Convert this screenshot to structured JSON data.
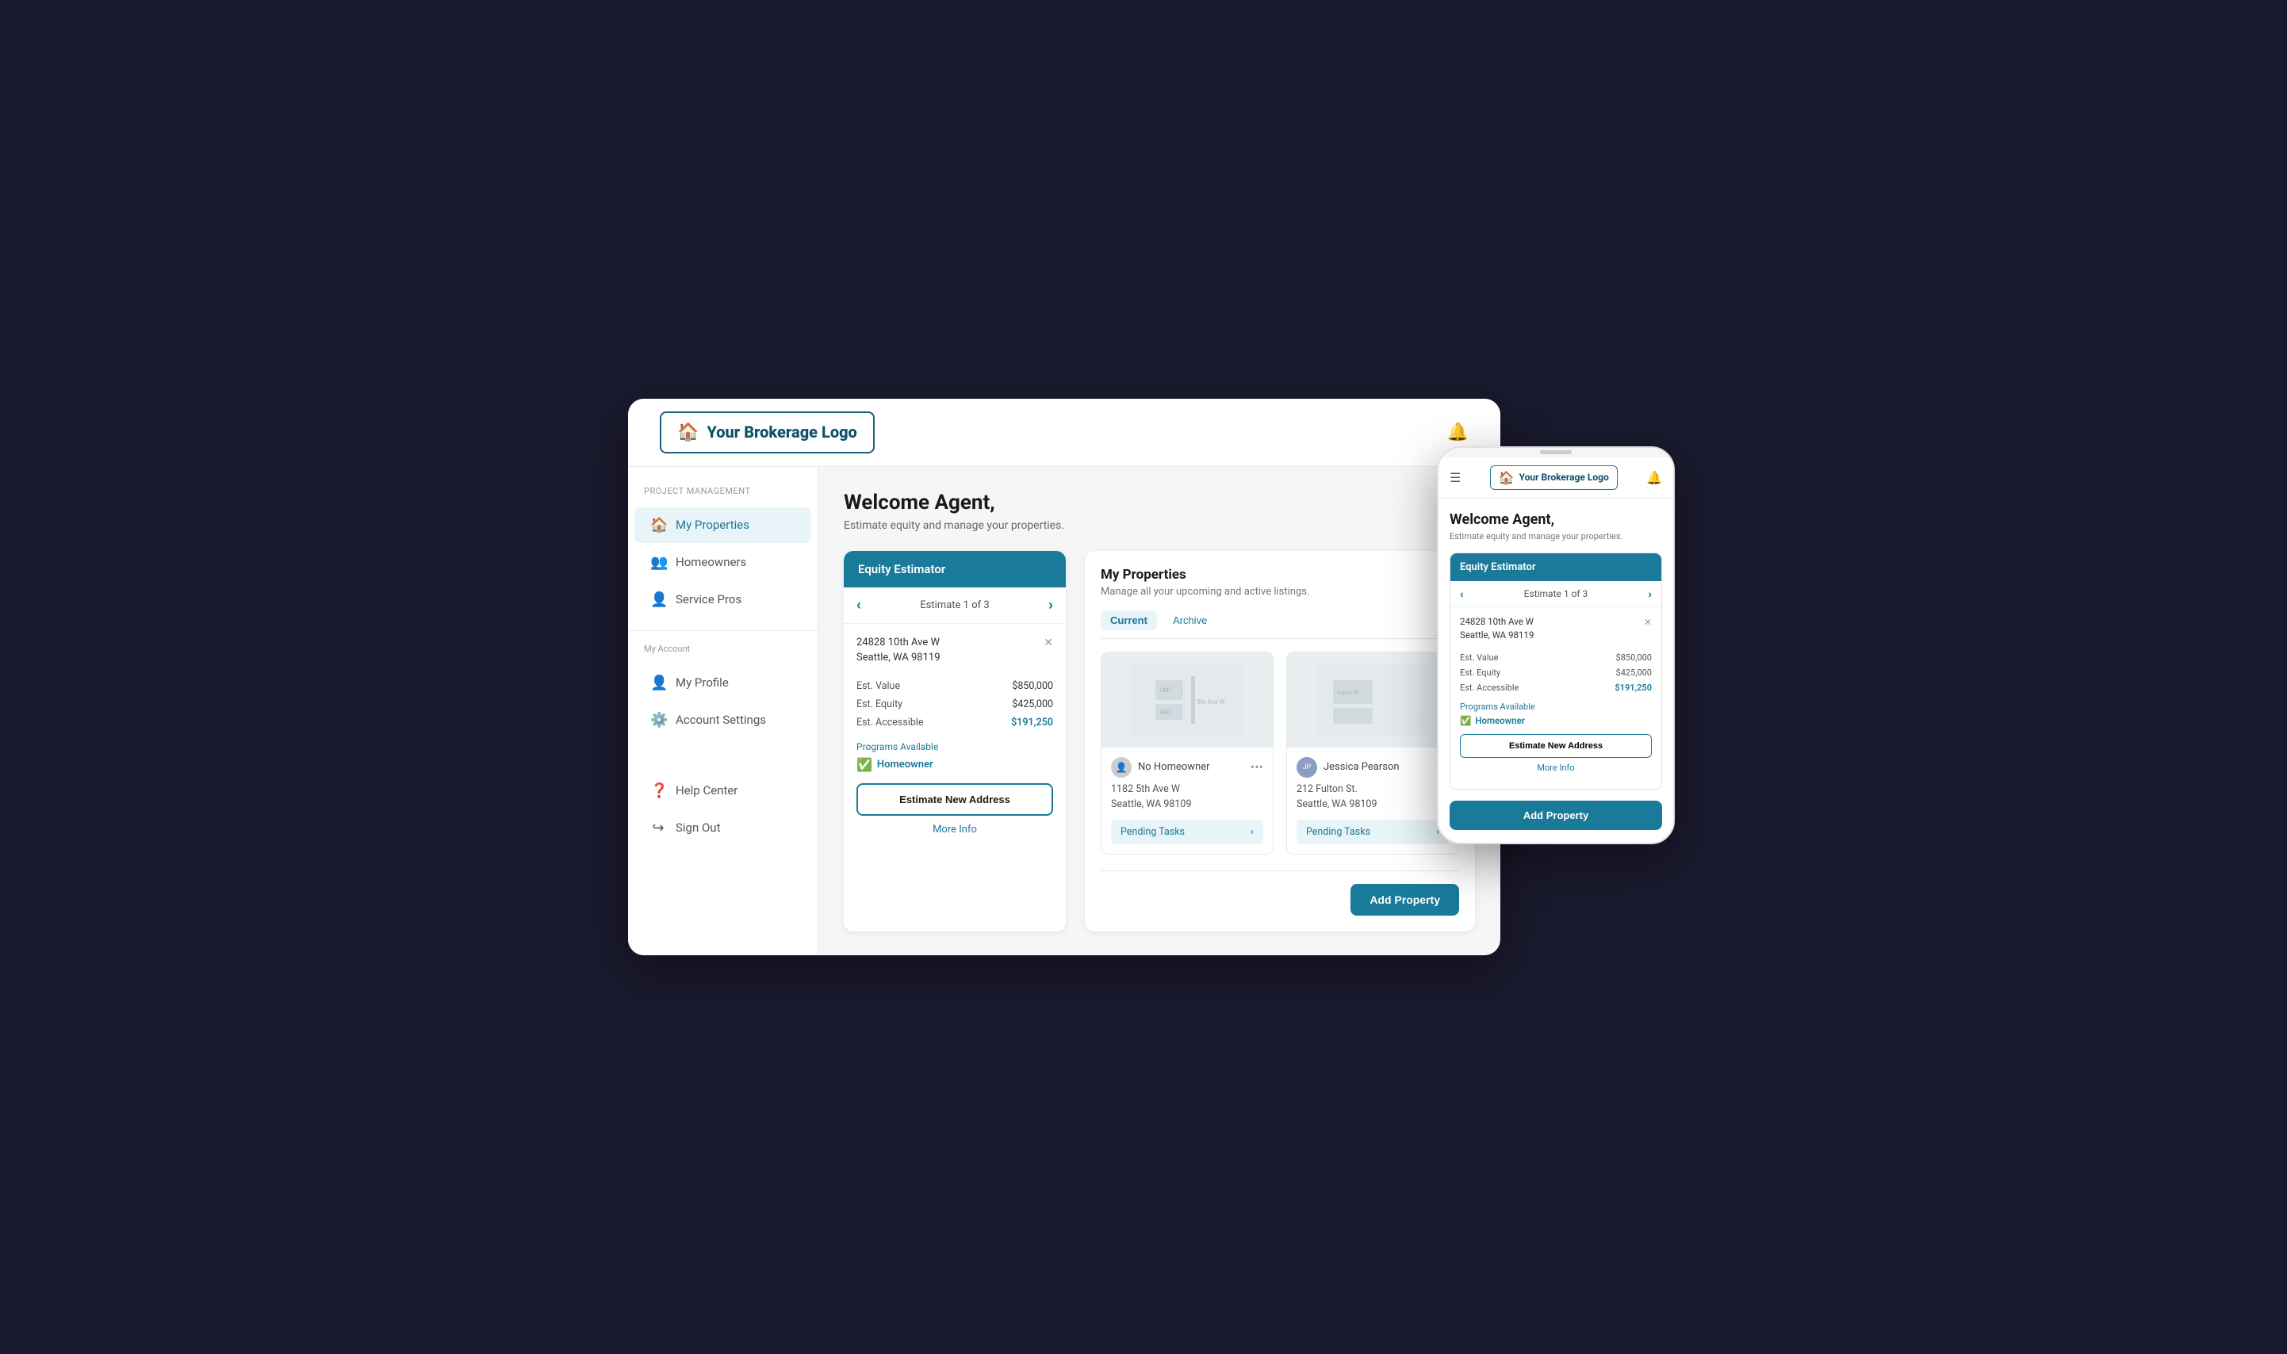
{
  "app": {
    "logo_text": "Your Brokerage Logo",
    "logo_icon": "🏠",
    "bell_icon": "🔔",
    "notification_icon": "🔔"
  },
  "sidebar": {
    "section_label": "Project Management",
    "items": [
      {
        "id": "my-properties",
        "label": "My Properties",
        "icon": "🏠",
        "active": true
      },
      {
        "id": "homeowners",
        "label": "Homeowners",
        "icon": "👥",
        "active": false
      },
      {
        "id": "service-pros",
        "label": "Service Pros",
        "icon": "👤",
        "active": false
      }
    ],
    "account_label": "My Account",
    "account_items": [
      {
        "id": "my-profile",
        "label": "My Profile",
        "icon": "👤"
      },
      {
        "id": "account-settings",
        "label": "Account Settings",
        "icon": "⚙️"
      }
    ],
    "bottom_items": [
      {
        "id": "help-center",
        "label": "Help Center",
        "icon": "❓"
      },
      {
        "id": "sign-out",
        "label": "Sign Out",
        "icon": "↪"
      }
    ]
  },
  "welcome": {
    "title": "Welcome Agent,",
    "subtitle": "Estimate equity and manage your properties."
  },
  "equity_estimator": {
    "header": "Equity Estimator",
    "nav_label": "Estimate 1 of 3",
    "address_line1": "24828 10th Ave W",
    "address_line2": "Seattle, WA 98119",
    "fields": [
      {
        "label": "Est. Value",
        "value": "$850,000",
        "highlight": false
      },
      {
        "label": "Est. Equity",
        "value": "$425,000",
        "highlight": false
      },
      {
        "label": "Est. Accessible",
        "value": "$191,250",
        "highlight": true
      }
    ],
    "programs_label": "Programs Available",
    "homeowner_badge": "Homeowner",
    "estimate_btn": "Estimate New Address",
    "more_info_link": "More Info"
  },
  "properties": {
    "title": "My Properties",
    "subtitle": "Manage all your upcoming and active listings.",
    "tabs": [
      {
        "label": "Current",
        "active": true
      },
      {
        "label": "Archive",
        "active": false
      }
    ],
    "cards": [
      {
        "owner_name": "No Homeowner",
        "has_avatar": false,
        "avatar_icon": "👤",
        "address_line1": "1182 5th Ave W",
        "address_line2": "Seattle, WA 98109",
        "pending_tasks_label": "Pending Tasks"
      },
      {
        "owner_name": "Jessica Pearson",
        "has_avatar": true,
        "avatar_initial": "JP",
        "address_line1": "212 Fulton St.",
        "address_line2": "Seattle, WA 98109",
        "pending_tasks_label": "Pending Tasks"
      }
    ],
    "add_property_btn": "Add Property"
  },
  "mobile": {
    "menu_icon": "☰",
    "logo_text": "Your Brokerage Logo",
    "logo_icon": "🏠",
    "bell_icon": "🔔",
    "welcome_title": "Welcome Agent,",
    "welcome_sub": "Estimate equity and manage your properties.",
    "equity_header": "Equity Estimator",
    "nav_label": "Estimate 1 of 3",
    "address_line1": "24828 10th Ave W",
    "address_line2": "Seattle, WA 98119",
    "fields": [
      {
        "label": "Est. Value",
        "value": "$850,000",
        "highlight": false
      },
      {
        "label": "Est. Equity",
        "value": "$425,000",
        "highlight": false
      },
      {
        "label": "Est. Accessible",
        "value": "$191,250",
        "highlight": true
      }
    ],
    "programs_label": "Programs Available",
    "homeowner_badge": "Homeowner",
    "estimate_btn": "Estimate New Address",
    "more_info": "More Info",
    "add_btn": "Add Property"
  }
}
